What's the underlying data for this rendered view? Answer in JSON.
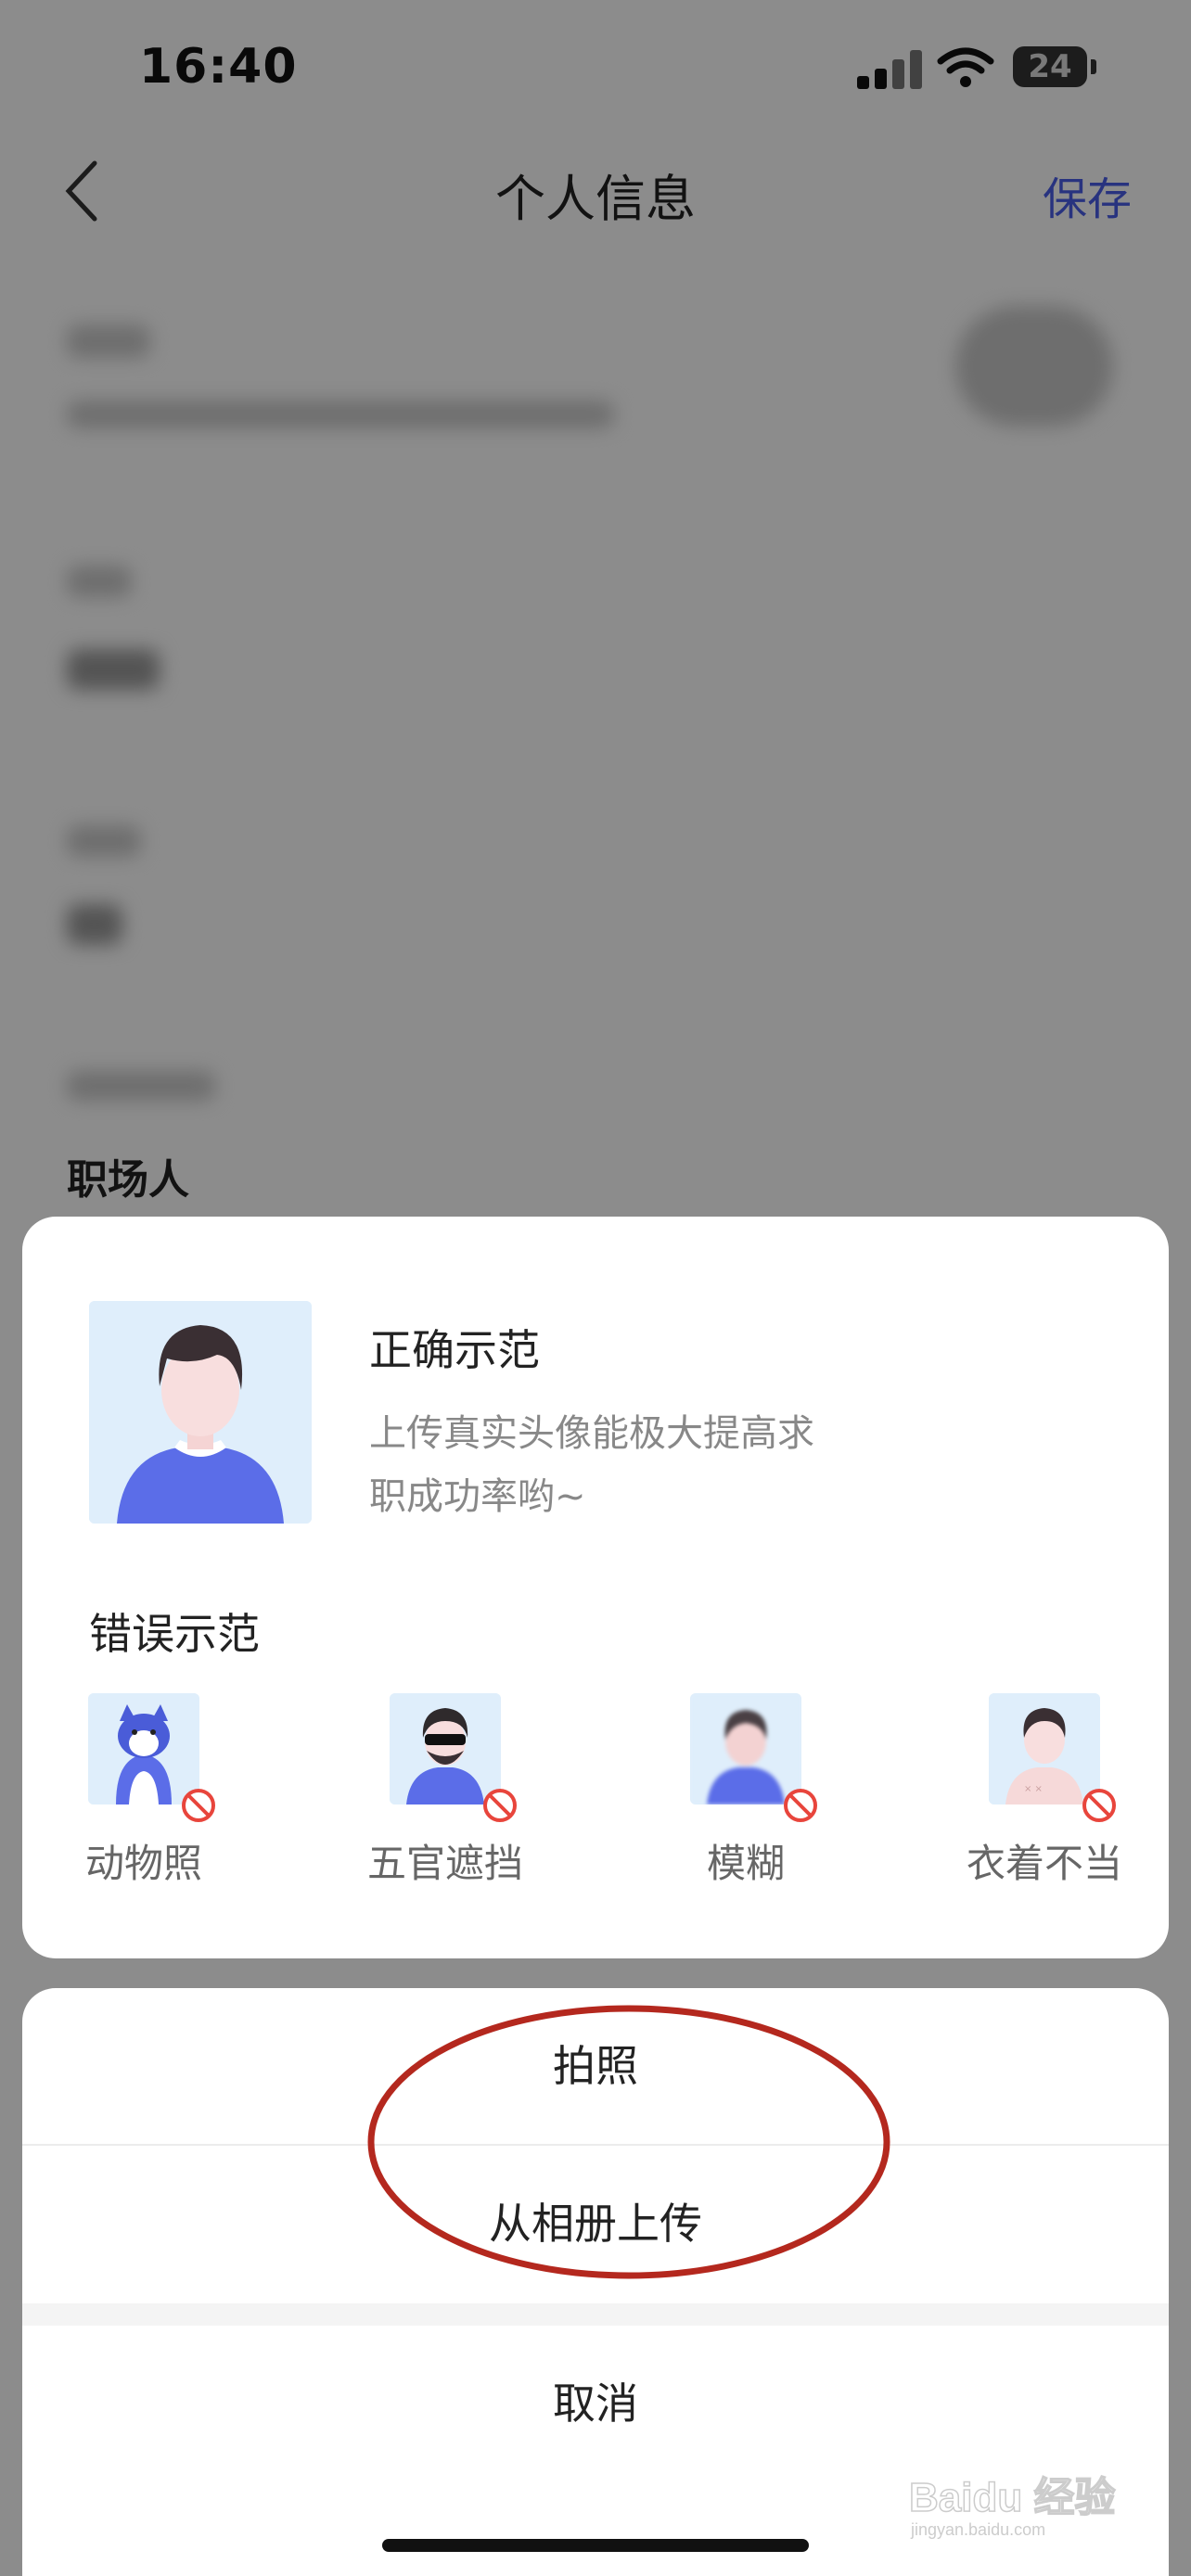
{
  "status_bar": {
    "time": "16:40",
    "battery": "24"
  },
  "nav": {
    "title": "个人信息",
    "save_label": "保存"
  },
  "background": {
    "career_label": "职场人"
  },
  "sheet": {
    "correct_title": "正确示范",
    "correct_desc_line1": "上传真实头像能极大提高求",
    "correct_desc_line2": "职成功率哟~",
    "wrong_title": "错误示范",
    "bad_examples": [
      {
        "label": "动物照",
        "icon": "animal-avatar-icon"
      },
      {
        "label": "五官遮挡",
        "icon": "covered-face-avatar-icon"
      },
      {
        "label": "模糊",
        "icon": "blurred-avatar-icon"
      },
      {
        "label": "衣着不当",
        "icon": "improper-clothing-avatar-icon"
      }
    ],
    "take_photo": "拍照",
    "upload_album": "从相册上传",
    "cancel": "取消"
  },
  "watermark": {
    "text": "Baidu 经验",
    "sub": "jingyan.baidu.com"
  },
  "colors": {
    "accent": "#4a5de8",
    "annotation_red": "#b4281e",
    "avatar_shirt": "#5b6de8"
  }
}
